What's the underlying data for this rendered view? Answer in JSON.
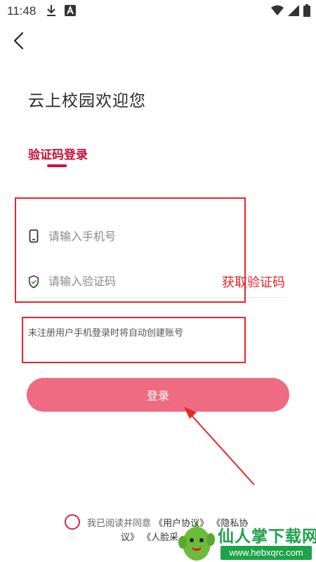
{
  "status_bar": {
    "time": "11:48"
  },
  "header": {
    "welcome": "云上校园欢迎您",
    "tab_label": "验证码登录"
  },
  "form": {
    "phone_placeholder": "请输入手机号",
    "code_placeholder": "请输入验证码",
    "get_code_label": "获取验证码",
    "notice": "未注册用户手机登录时将自动创建账号",
    "login_label": "登录"
  },
  "agreement": {
    "prefix": "我已阅读并同意",
    "user_agreement": "《用户协议》",
    "privacy_part1": "《隐私协",
    "privacy_part2": "议》",
    "face_agreement": "《人脸采"
  },
  "watermark": {
    "title": "仙人掌下载网",
    "url": "www.hebxqrc.com"
  },
  "colors": {
    "accent": "#c8103a",
    "button": "#ee6b81",
    "annotation": "#e8262a",
    "watermark_green": "#1ea24a"
  },
  "icons": [
    "download-icon",
    "a-notification-icon",
    "wifi-icon",
    "signal-icon",
    "battery-icon",
    "back-arrow-icon",
    "phone-icon",
    "shield-check-icon"
  ]
}
